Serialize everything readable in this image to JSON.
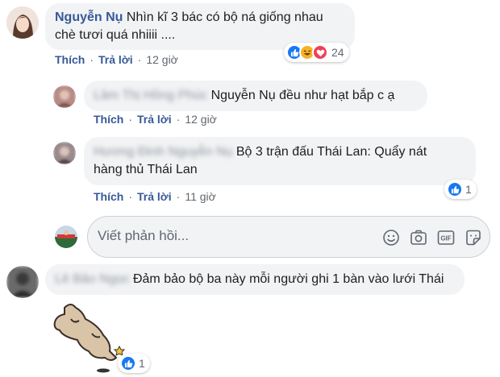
{
  "comments": [
    {
      "author": "Nguyễn Nụ",
      "text_line1": "Nhìn kĩ 3 bác có bộ ná giống nhau",
      "text_line2": "chè tươi quá nhiiii ....",
      "like_label": "Thích",
      "reply_label": "Trả lời",
      "time": "12 giờ",
      "reaction_count": "24"
    },
    {
      "author": "Lâm Thị Hồng Phúc",
      "text": "Nguyễn Nụ đều như hạt bắp c ạ",
      "like_label": "Thích",
      "reply_label": "Trả lời",
      "time": "12 giờ"
    },
    {
      "author": "Hương Đinh Nguyễn Nụ",
      "text_line1": "Bộ 3 trận đấu Thái Lan: Quẩy nát",
      "text_line2": "hàng thủ Thái Lan",
      "like_label": "Thích",
      "reply_label": "Trả lời",
      "time": "11 giờ",
      "reaction_count": "1"
    },
    {
      "author": "Lê Bảo Ngọc",
      "text": "Đảm bảo bộ ba này mỗi người ghi 1 bàn vào lưới Thái",
      "reaction_count": "1"
    }
  ],
  "reply_box": {
    "placeholder": "Viết phản hồi...",
    "icons": [
      "emoji-icon",
      "camera-icon",
      "gif-icon",
      "sticker-icon"
    ]
  },
  "colors": {
    "link": "#385898",
    "bubble": "#f2f3f5",
    "like": "#1877f2",
    "haha": "#f7b125",
    "love": "#f33e58"
  }
}
